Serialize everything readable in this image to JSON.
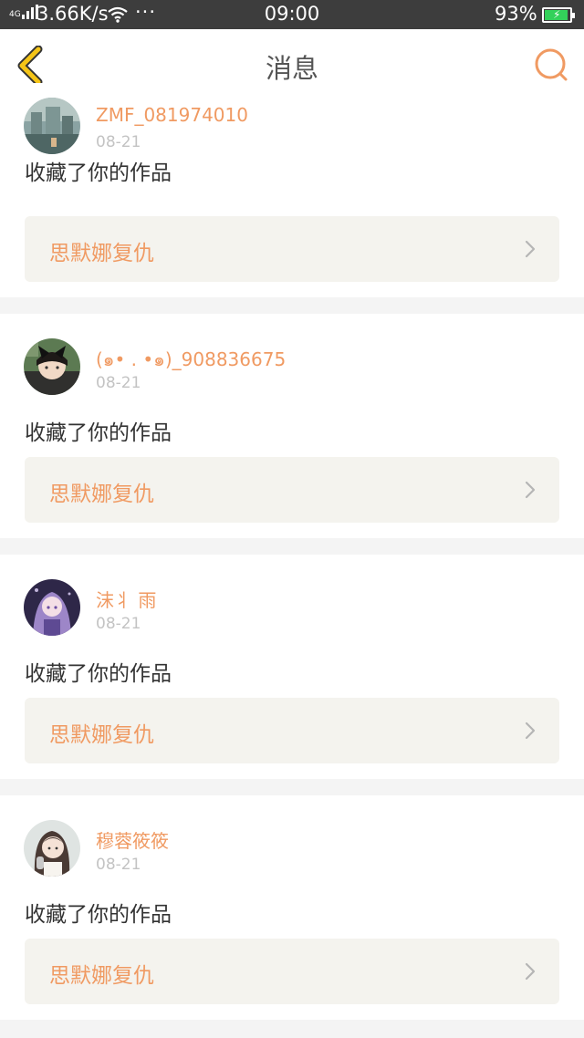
{
  "status_bar": {
    "network": "4G",
    "speed": "3.66K/s",
    "more": "···",
    "time": "09:00",
    "battery_percent": "93%",
    "battery_level": 0.93,
    "colors": {
      "background": "#3d3d3d",
      "battery_fill": "#33d15a"
    }
  },
  "header": {
    "title": "消息",
    "back_icon": "chevron-left-icon",
    "search_icon": "search-icon",
    "colors": {
      "back": "#f5c518",
      "search": "#f09a62"
    }
  },
  "messages": [
    {
      "user": "ZMF_081974010",
      "date": "08-21",
      "action": "收藏了你的作品",
      "work_title": "思默娜复仇",
      "avatar": "landscape-avatar"
    },
    {
      "user": "(๑• . •๑)_908836675",
      "date": "08-21",
      "action": "收藏了你的作品",
      "work_title": "思默娜复仇",
      "avatar": "cat-ears-avatar"
    },
    {
      "user": "沫丬 雨",
      "date": "08-21",
      "action": "收藏了你的作品",
      "work_title": "思默娜复仇",
      "avatar": "anime-girl-avatar"
    },
    {
      "user": "穆蓉筱筱",
      "date": "08-21",
      "action": "收藏了你的作品",
      "work_title": "思默娜复仇",
      "avatar": "girl-photo-avatar"
    }
  ],
  "colors": {
    "accent": "#f09a62",
    "page_background": "#f4f4f4",
    "work_background": "#f4f3ee",
    "date": "#c3c3c3"
  }
}
